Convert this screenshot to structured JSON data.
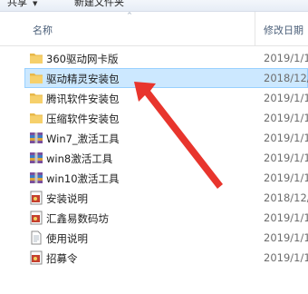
{
  "toolbar": {
    "share_label": "共享",
    "new_folder_label": "新建文件夹"
  },
  "columns": {
    "name": "名称",
    "modified": "修改日期"
  },
  "files": [
    {
      "name": "360驱动网卡版",
      "date": "2019/1/1",
      "icon": "folder-icon",
      "selected": false
    },
    {
      "name": "驱动精灵安装包",
      "date": "2018/12/",
      "icon": "folder-icon",
      "selected": true
    },
    {
      "name": "腾讯软件安装包",
      "date": "2019/1/1",
      "icon": "folder-icon",
      "selected": false
    },
    {
      "name": "压缩软件安装包",
      "date": "2019/1/1",
      "icon": "folder-icon",
      "selected": false
    },
    {
      "name": "Win7_激活工具",
      "date": "2019/1/1",
      "icon": "archive-icon",
      "selected": false
    },
    {
      "name": "win8激活工具",
      "date": "2019/1/1",
      "icon": "archive-icon",
      "selected": false
    },
    {
      "name": "win10激活工具",
      "date": "2019/1/1",
      "icon": "archive-icon",
      "selected": false
    },
    {
      "name": "安装说明",
      "date": "2018/12/",
      "icon": "picture-icon",
      "selected": false
    },
    {
      "name": "汇鑫易数码坊",
      "date": "2019/1/1",
      "icon": "picture-icon",
      "selected": false
    },
    {
      "name": "使用说明",
      "date": "2019/1/1",
      "icon": "text-file-icon",
      "selected": false
    },
    {
      "name": "招募令",
      "date": "2019/1/1",
      "icon": "picture-icon",
      "selected": false
    }
  ],
  "colors": {
    "selection": "#cce8ff",
    "selection_border": "#99d1ff",
    "annotation_arrow": "#e8352d"
  }
}
